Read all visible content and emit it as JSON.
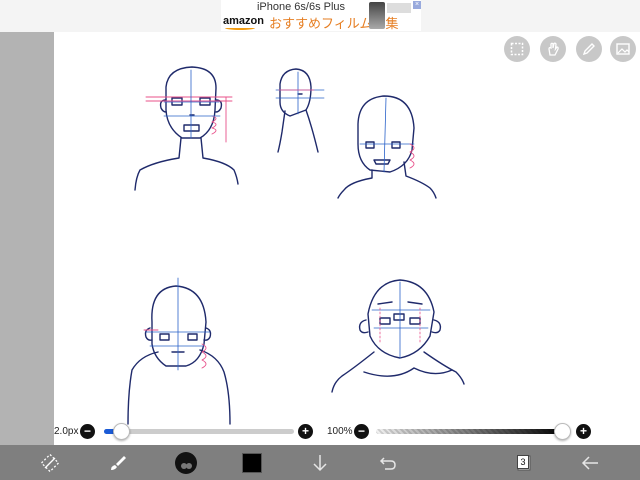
{
  "ad": {
    "title": "iPhone 6s/6s Plus",
    "brand": "amazon",
    "promo": "おすすめフィルム特集",
    "badge": "",
    "close": "×"
  },
  "colors": {
    "accent": "#1b5bd6",
    "toolbar": "#7f7f7f",
    "side_strip": "#b3b3b3",
    "guide_pink": "#e8508a",
    "guide_blue": "#2a62c9"
  },
  "top_tools": [
    {
      "name": "selection-icon"
    },
    {
      "name": "hand-icon"
    },
    {
      "name": "eraser-pen-icon"
    },
    {
      "name": "image-icon"
    }
  ],
  "brush_size": {
    "label": "2.0px",
    "minus": "−",
    "plus": "+",
    "level": 0.09
  },
  "opacity": {
    "label": "100%",
    "minus": "−",
    "plus": "+",
    "level": 1.0
  },
  "toolbar": {
    "items": [
      {
        "name": "transform-icon"
      },
      {
        "name": "brush-icon"
      },
      {
        "name": "brush-preview-icon"
      },
      {
        "name": "color-swatch",
        "color": "#000000"
      },
      {
        "name": "download-icon"
      },
      {
        "name": "undo-icon"
      },
      {
        "name": "layers-icon"
      },
      {
        "name": "back-arrow-icon"
      }
    ],
    "layer_count": "3"
  }
}
